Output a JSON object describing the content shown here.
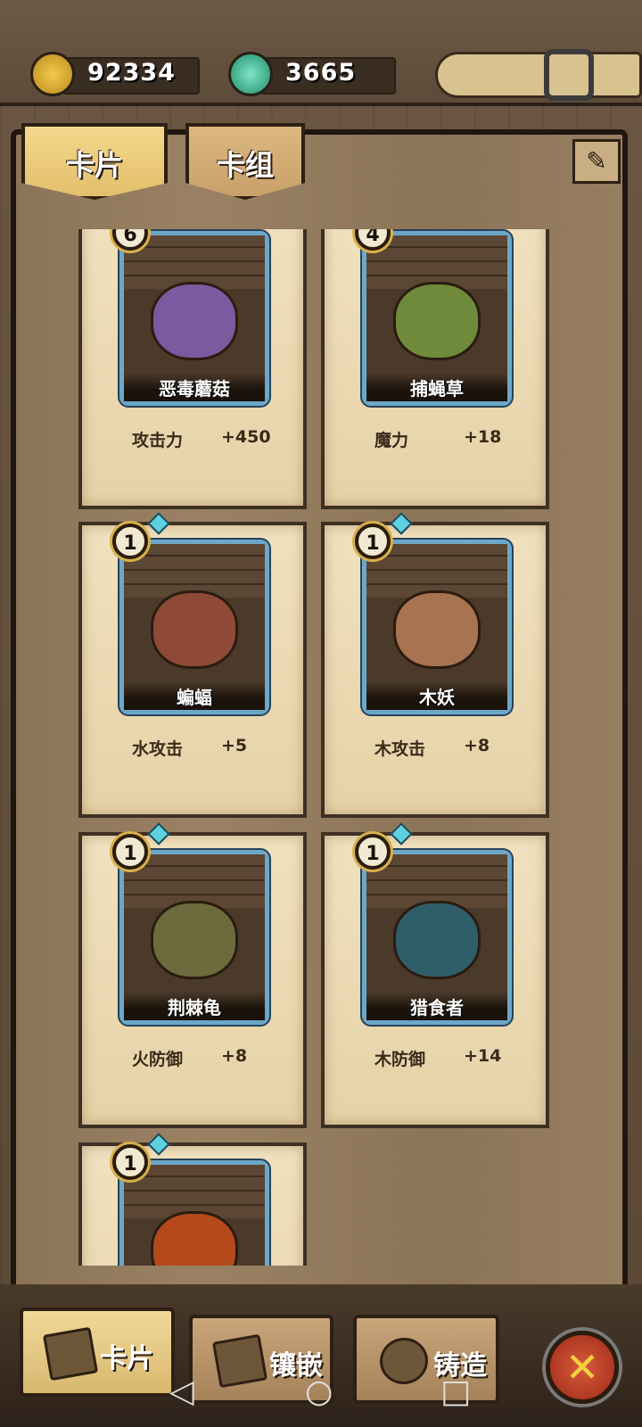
{
  "resources": {
    "gold": "92334",
    "gems": "3665",
    "gold_icon": "gold-nugget-icon",
    "gem_icon": "green-gem-icon"
  },
  "tabs": [
    {
      "label": "卡片",
      "active": true
    },
    {
      "label": "卡组",
      "active": false
    }
  ],
  "edit_icon": "brush-icon",
  "cards": [
    {
      "name": "恶毒蘑菇",
      "level": "6",
      "stat": "攻击力",
      "value": "+450",
      "color": "#7b5aa0"
    },
    {
      "name": "捕蝇草",
      "level": "4",
      "stat": "魔力",
      "value": "+18",
      "color": "#6f8a3a"
    },
    {
      "name": "蝙蝠",
      "level": "1",
      "stat": "水攻击",
      "value": "+5",
      "color": "#8e4a37"
    },
    {
      "name": "木妖",
      "level": "1",
      "stat": "木攻击",
      "value": "+8",
      "color": "#a87350"
    },
    {
      "name": "荆棘龟",
      "level": "1",
      "stat": "火防御",
      "value": "+8",
      "color": "#6d6b3e"
    },
    {
      "name": "猎食者",
      "level": "1",
      "stat": "木防御",
      "value": "+14",
      "color": "#2f5e6a"
    },
    {
      "name": "",
      "level": "1",
      "stat": "",
      "value": "",
      "color": "#b4491c"
    }
  ],
  "bottom_nav": [
    {
      "label": "卡片"
    },
    {
      "label": "镶嵌"
    },
    {
      "label": "铸造"
    }
  ],
  "close_symbol": "✕",
  "system_nav": {
    "back": "◁",
    "home": "○",
    "recent": "□"
  }
}
